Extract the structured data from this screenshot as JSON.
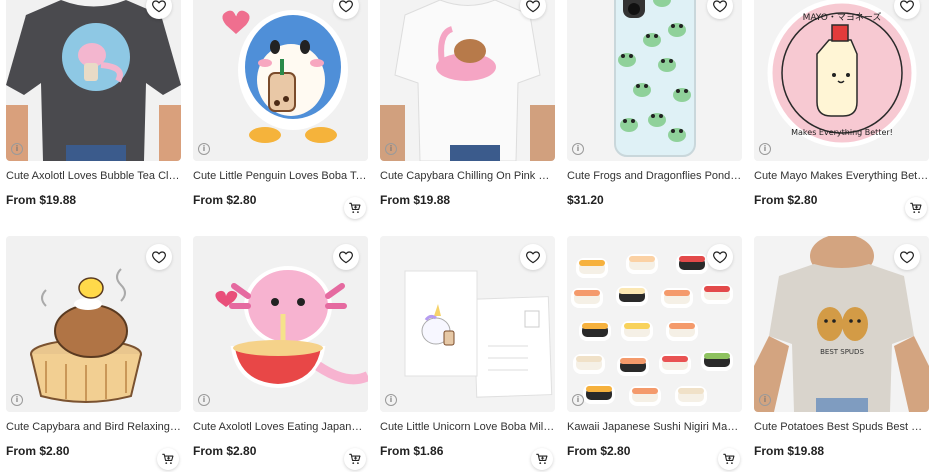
{
  "products": [
    {
      "title": "Cute Axolotl Loves Bubble Tea Classic T-Shirt",
      "price": "From $19.88",
      "bg": "#f3f3f3",
      "icon": "axolotl-tshirt-image",
      "has_cart": false
    },
    {
      "title": "Cute Little Penguin Loves Boba Tea Sticker",
      "price": "From $2.80",
      "bg": "#f3f3f3",
      "icon": "penguin-sticker-image",
      "has_cart": true
    },
    {
      "title": "Cute Capybara Chilling On Pink Flamingo Float T-Shirt",
      "price": "From $19.88",
      "bg": "#f3f3f3",
      "icon": "capybara-tshirt-image",
      "has_cart": false
    },
    {
      "title": "Cute Frogs and Dragonflies Pond Phone Case",
      "price": "$31.20",
      "bg": "#f3f3f3",
      "icon": "frog-phone-case-image",
      "has_cart": false
    },
    {
      "title": "Cute Mayo Makes Everything Better Sticker",
      "price": "From $2.80",
      "bg": "#f3f3f3",
      "icon": "mayo-sticker-image",
      "has_cart": true
    },
    {
      "title": "Cute Capybara and Bird Relaxing in Onsen Sticker",
      "price": "From $2.80",
      "bg": "#f3f3f3",
      "icon": "capybara-onsen-sticker-image",
      "has_cart": true
    },
    {
      "title": "Cute Axolotl Loves Eating Japanese Ramen Sticker",
      "price": "From $2.80",
      "bg": "#f3f3f3",
      "icon": "axolotl-ramen-sticker-image",
      "has_cart": true
    },
    {
      "title": "Cute Little Unicorn Love Boba Milk Tea Postcard",
      "price": "From $1.86",
      "bg": "#f3f3f3",
      "icon": "unicorn-postcard-image",
      "has_cart": true
    },
    {
      "title": "Kawaii Japanese Sushi Nigiri Maki Sticker Pack",
      "price": "From $2.80",
      "bg": "#f3f3f3",
      "icon": "sushi-sticker-pack-image",
      "has_cart": true
    },
    {
      "title": "Cute Potatoes Best Spuds Best Buds T-Shirt",
      "price": "From $19.88",
      "bg": "#f3f3f3",
      "icon": "potatoes-tshirt-image",
      "has_cart": false
    }
  ],
  "art_text": {
    "mayo_top": "MAYO・マヨネーズ",
    "mayo_bottom": "Makes Everything Better!",
    "spuds": "BEST SPUDS"
  },
  "colors": {
    "accent_heart": "#222222",
    "card_bg": "#f3f3f3"
  }
}
